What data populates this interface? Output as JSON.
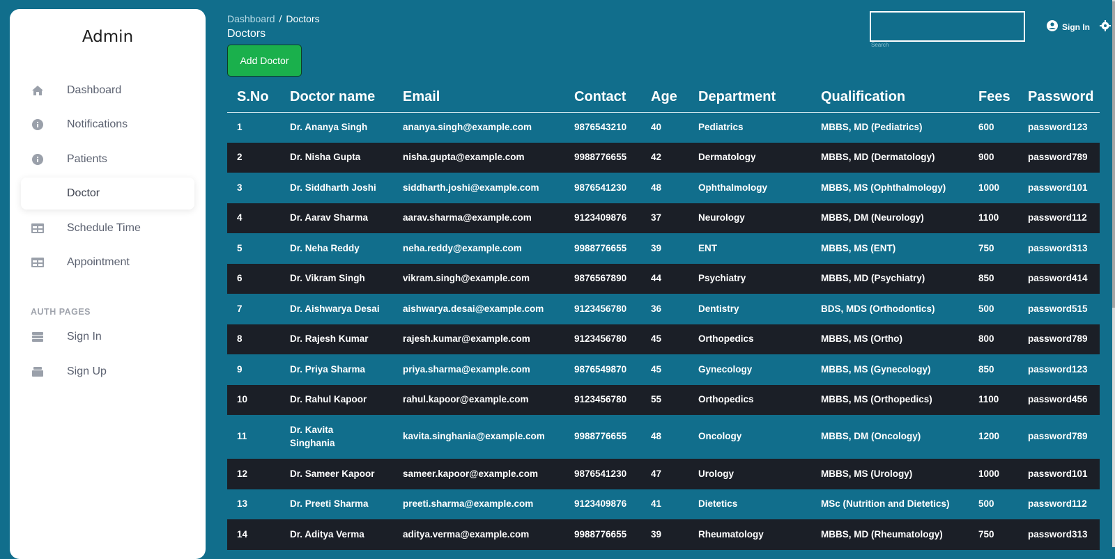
{
  "sidebar": {
    "brand": "Admin",
    "items": [
      {
        "label": "Dashboard"
      },
      {
        "label": "Notifications"
      },
      {
        "label": "Patients"
      },
      {
        "label": "Doctor"
      },
      {
        "label": "Schedule Time"
      },
      {
        "label": "Appointment"
      }
    ],
    "section_title": "AUTH PAGES",
    "auth_items": [
      {
        "label": "Sign In"
      },
      {
        "label": "Sign Up"
      }
    ]
  },
  "header": {
    "breadcrumb_root": "Dashboard",
    "breadcrumb_sep": "/",
    "breadcrumb_current": "Doctors",
    "title": "Doctors",
    "add_button": "Add Doctor",
    "search_value": "",
    "search_caption": "Search",
    "signin": "Sign In"
  },
  "table": {
    "columns": [
      "S.No",
      "Doctor name",
      "Email",
      "Contact",
      "Age",
      "Department",
      "Qualification",
      "Fees",
      "Password"
    ],
    "rows": [
      [
        "1",
        "Dr. Ananya Singh",
        "ananya.singh@example.com",
        "9876543210",
        "40",
        "Pediatrics",
        "MBBS, MD (Pediatrics)",
        "600",
        "password123"
      ],
      [
        "2",
        "Dr. Nisha Gupta",
        "nisha.gupta@example.com",
        "9988776655",
        "42",
        "Dermatology",
        "MBBS, MD (Dermatology)",
        "900",
        "password789"
      ],
      [
        "3",
        "Dr. Siddharth Joshi",
        "siddharth.joshi@example.com",
        "9876541230",
        "48",
        "Ophthalmology",
        "MBBS, MS (Ophthalmology)",
        "1000",
        "password101"
      ],
      [
        "4",
        "Dr. Aarav Sharma",
        "aarav.sharma@example.com",
        "9123409876",
        "37",
        "Neurology",
        "MBBS, DM (Neurology)",
        "1100",
        "password112"
      ],
      [
        "5",
        "Dr. Neha Reddy",
        "neha.reddy@example.com",
        "9988776655",
        "39",
        "ENT",
        "MBBS, MS (ENT)",
        "750",
        "password313"
      ],
      [
        "6",
        "Dr. Vikram Singh",
        "vikram.singh@example.com",
        "9876567890",
        "44",
        "Psychiatry",
        "MBBS, MD (Psychiatry)",
        "850",
        "password414"
      ],
      [
        "7",
        "Dr. Aishwarya Desai",
        "aishwarya.desai@example.com",
        "9123456780",
        "36",
        "Dentistry",
        "BDS, MDS (Orthodontics)",
        "500",
        "password515"
      ],
      [
        "8",
        "Dr. Rajesh Kumar",
        "rajesh.kumar@example.com",
        "9123456780",
        "45",
        "Orthopedics",
        "MBBS, MS (Ortho)",
        "800",
        "password789"
      ],
      [
        "9",
        "Dr. Priya Sharma",
        "priya.sharma@example.com",
        "9876549870",
        "45",
        "Gynecology",
        "MBBS, MS (Gynecology)",
        "850",
        "password123"
      ],
      [
        "10",
        "Dr. Rahul Kapoor",
        "rahul.kapoor@example.com",
        "9123456780",
        "55",
        "Orthopedics",
        "MBBS, MS (Orthopedics)",
        "1100",
        "password456"
      ],
      [
        "11",
        "Dr. Kavita Singhania",
        "kavita.singhania@example.com",
        "9988776655",
        "48",
        "Oncology",
        "MBBS, DM (Oncology)",
        "1200",
        "password789"
      ],
      [
        "12",
        "Dr. Sameer Kapoor",
        "sameer.kapoor@example.com",
        "9876541230",
        "47",
        "Urology",
        "MBBS, MS (Urology)",
        "1000",
        "password101"
      ],
      [
        "13",
        "Dr. Preeti Sharma",
        "preeti.sharma@example.com",
        "9123409876",
        "41",
        "Dietetics",
        "MSc (Nutrition and Dietetics)",
        "500",
        "password112"
      ],
      [
        "14",
        "Dr. Aditya Verma",
        "aditya.verma@example.com",
        "9988776655",
        "39",
        "Rheumatology",
        "MBBS, MD (Rheumatology)",
        "750",
        "password313"
      ]
    ]
  },
  "colors": {
    "background": "#116e8c",
    "dark_row": "#1b1f27",
    "button": "#1ab04c"
  },
  "icons": {
    "dashboard": "home-icon",
    "notifications": "info-icon",
    "patients": "info-icon",
    "schedule": "table-icon",
    "appointment": "table-icon",
    "signin": "stack-icon",
    "signup": "stack-icon",
    "user": "user-circle-icon",
    "settings": "gear-icon"
  }
}
